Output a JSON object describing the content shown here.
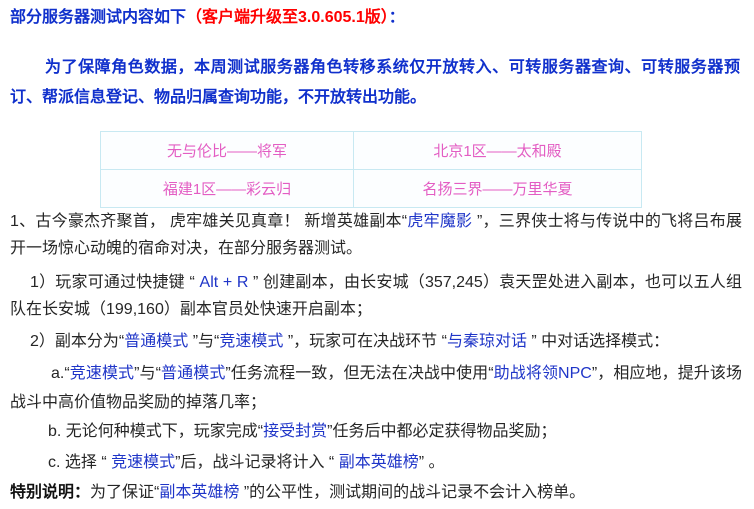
{
  "header": {
    "title": "部分服务器测试内容如下",
    "client_version": "（客户端升级至3.0.605.1版）",
    "colon": "：",
    "notice": "为了保障角色数据，本周测试服务器角色转移系统仅开放转入、可转服务器查询、可转服务器预订、帮派信息登记、物品归属查询功能，不开放转出功能。"
  },
  "server_table": {
    "rows": [
      [
        "无与伦比——将军",
        "北京1区——太和殿"
      ],
      [
        "福建1区——彩云归",
        "名扬三界——万里华夏"
      ]
    ]
  },
  "dungeon": {
    "intro": [
      "1、古今豪杰齐聚首， 虎牢雄关见真章！ 新增英雄副本“",
      "虎牢魔影",
      " ”，三界侠士将与传说中的飞将吕布展开一场惊心动魄的宿命对决，在部分服务器测试。"
    ],
    "entry": [
      "1）玩家可通过快捷键 “ ",
      "Alt + R",
      " ” 创建副本，由长安城（357,245）袁天罡处进入副本，也可以五人组队在长安城（199,160）副本官员处快速开启副本；"
    ],
    "modes": [
      "2）副本分为“",
      "普通模式",
      " ”与“",
      "竞速模式",
      " ”，玩家可在决战环节 “",
      "与秦琼对话",
      " ” 中对话选择模式："
    ],
    "mode_a": [
      "a.“",
      "竞速模式",
      "”与“",
      "普通模式",
      "”任务流程一致，但无法在决战中使用“",
      "助战将领NPC",
      "”，相应地，提升该场战斗中高价值物品奖励的掉落几率；"
    ],
    "mode_b": [
      "b. 无论何种模式下，玩家完成“",
      "接受封赏",
      "”任务后中都必定获得物品奖励；"
    ],
    "mode_c": [
      "c. 选择 “ ",
      "竞速模式",
      "”后，战斗记录将计入 “ ",
      "副本英雄榜",
      "” 。"
    ]
  },
  "special_note": {
    "label": "特别说明：",
    "text": [
      "为了保证“",
      "副本英雄榜",
      " ”的公平性，测试期间的战斗记录不会计入榜单。"
    ]
  },
  "colors": {
    "heading_blue": "#1030cc",
    "version_red": "#ff0000",
    "highlight_blue": "#1f35c8",
    "body_text": "#262626",
    "table_text": "#e35dc3",
    "table_border": "#c8e9f2"
  }
}
